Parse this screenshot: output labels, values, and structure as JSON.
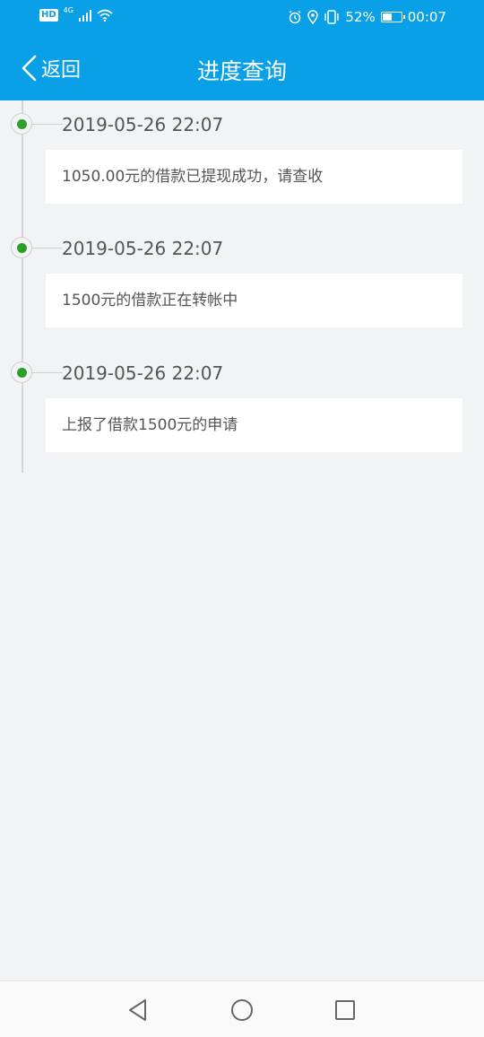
{
  "status_bar": {
    "hd": "HD",
    "network": "4G",
    "battery_percent": "52%",
    "battery_level": 0.52,
    "time": "00:07"
  },
  "header": {
    "back_label": "返回",
    "title": "进度查询"
  },
  "timeline": [
    {
      "time": "2019-05-26 22:07",
      "message": "1050.00元的借款已提现成功，请查收"
    },
    {
      "time": "2019-05-26 22:07",
      "message": "1500元的借款正在转帐中"
    },
    {
      "time": "2019-05-26 22:07",
      "message": "上报了借款1500元的申请"
    }
  ],
  "colors": {
    "accent": "#0aa0e8",
    "status_dot": "#2aa02a",
    "background": "#f2f3f5"
  },
  "icons": [
    "back-chevron-icon",
    "wifi-icon",
    "alarm-icon",
    "location-icon",
    "vibrate-icon",
    "battery-icon",
    "nav-back-icon",
    "nav-home-icon",
    "nav-recents-icon"
  ]
}
